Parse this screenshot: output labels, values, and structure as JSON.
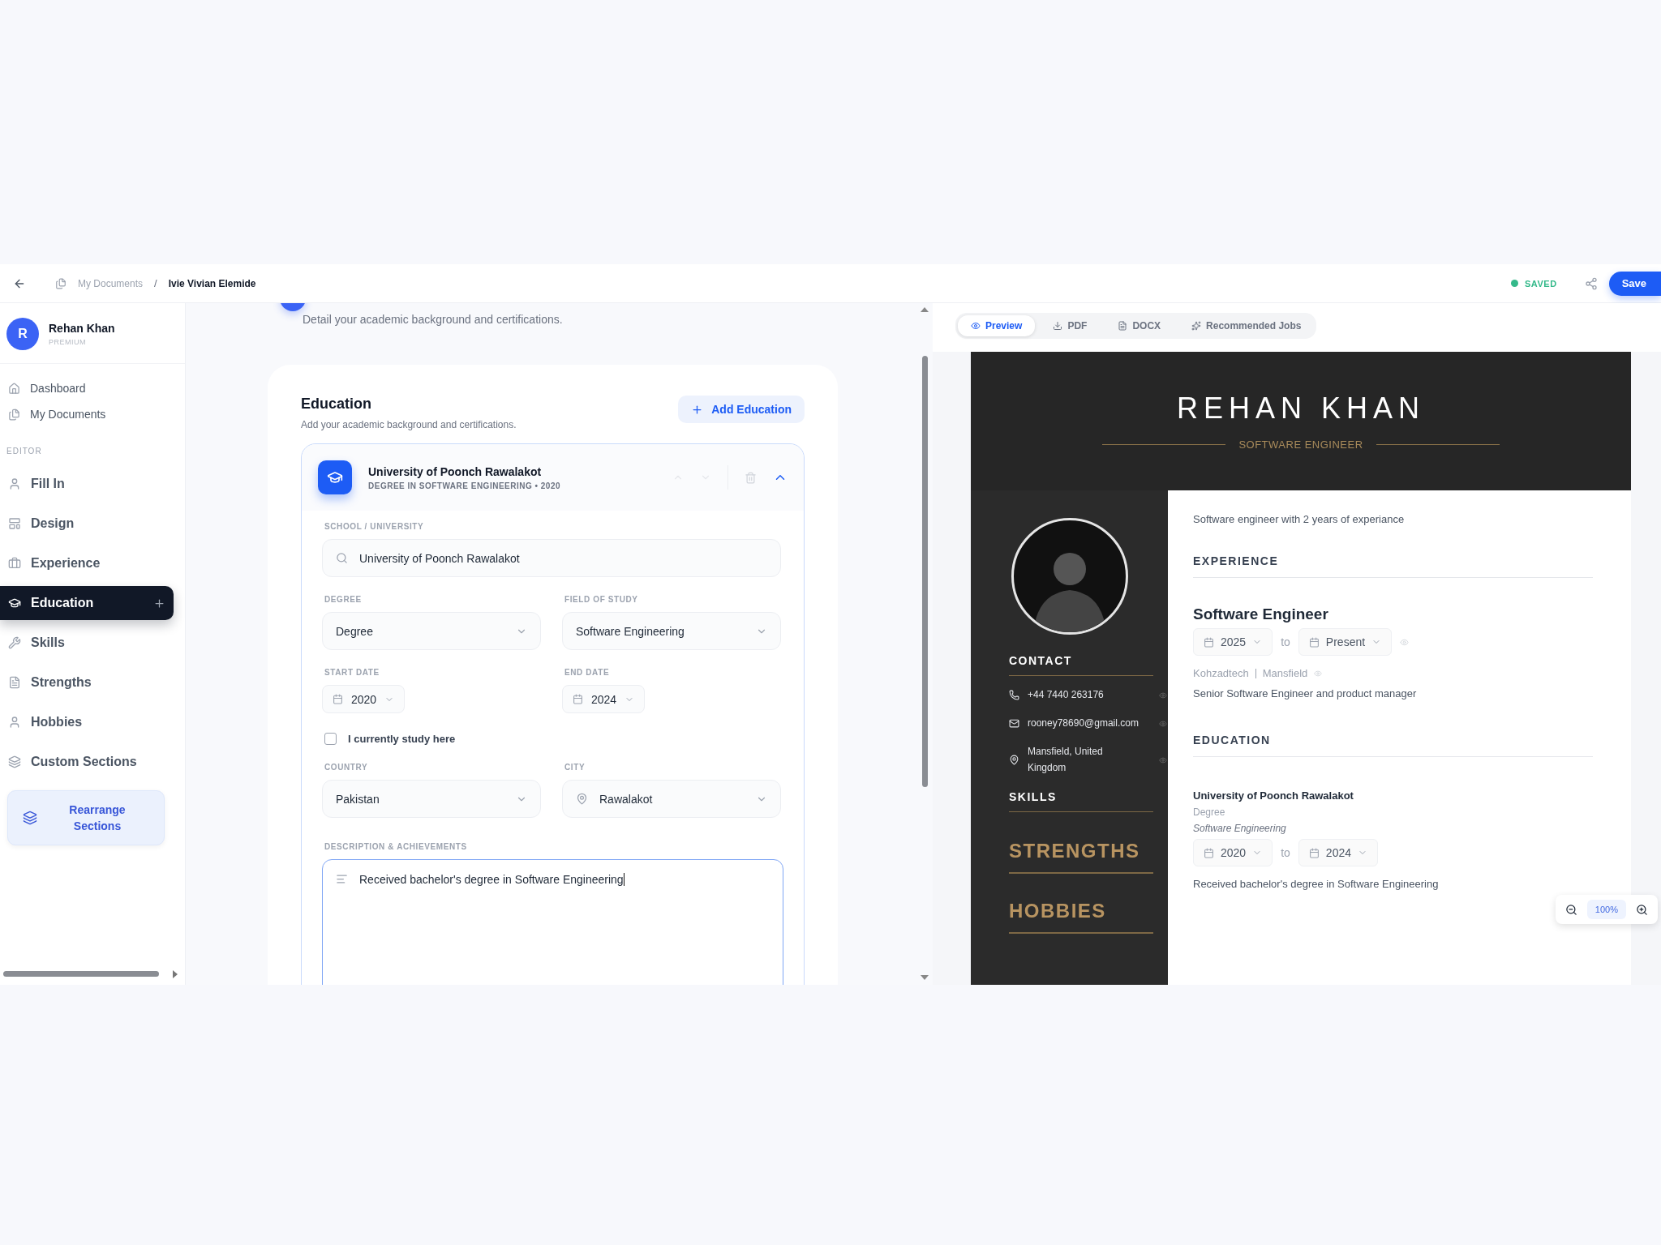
{
  "topbar": {
    "breadcrumb": [
      {
        "label": "My Documents",
        "current": false
      },
      {
        "label": "Ivie Vivian Elemide",
        "current": true
      }
    ],
    "separator": "/",
    "status": "SAVED",
    "save_button": "Save"
  },
  "sidebar": {
    "user": {
      "initial": "R",
      "name": "Rehan Khan",
      "plan": "PREMIUM"
    },
    "nav": [
      {
        "label": "Dashboard",
        "selected": false
      },
      {
        "label": "My Documents",
        "selected": false
      }
    ],
    "editor_label": "EDITOR",
    "editor_items": [
      {
        "label": "Fill In",
        "selected": false
      },
      {
        "label": "Design",
        "selected": false
      },
      {
        "label": "Experience",
        "selected": false
      },
      {
        "label": "Education",
        "selected": true
      },
      {
        "label": "Skills",
        "selected": false
      },
      {
        "label": "Strengths",
        "selected": false
      },
      {
        "label": "Hobbies",
        "selected": false
      },
      {
        "label": "Custom Sections",
        "selected": false
      }
    ],
    "rearrange_button": "Rearrange Sections"
  },
  "form": {
    "intro": "Detail your academic background and certifications.",
    "title": "Education",
    "subtitle": "Add your academic background and certifications.",
    "add_button": "Add Education",
    "entries": [
      {
        "title": "University of Poonch Rawalakot",
        "subtitle": "DEGREE IN SOFTWARE ENGINEERING • 2020",
        "expanded": true,
        "school": {
          "label": "SCHOOL / UNIVERSITY",
          "value": "University of Poonch Rawalakot"
        },
        "degree": {
          "label": "DEGREE",
          "value": "Degree"
        },
        "field_of_study": {
          "label": "FIELD OF STUDY",
          "value": "Software Engineering"
        },
        "start_date": {
          "label": "START DATE",
          "value": "2020"
        },
        "end_date": {
          "label": "END DATE",
          "value": "2024"
        },
        "current": {
          "label": "I currently study here",
          "checked": false
        },
        "country": {
          "label": "COUNTRY",
          "value": "Pakistan"
        },
        "city": {
          "label": "CITY",
          "value": "Rawalakot"
        },
        "description": {
          "label": "DESCRIPTION & ACHIEVEMENTS",
          "value": "Received bachelor's degree in Software Engineering"
        }
      }
    ]
  },
  "preview": {
    "tabs": [
      {
        "label": "Preview",
        "selected": true
      },
      {
        "label": "PDF",
        "selected": false
      },
      {
        "label": "DOCX",
        "selected": false
      },
      {
        "label": "Recommended Jobs",
        "selected": false
      }
    ],
    "resume": {
      "name": "REHAN KHAN",
      "title": "SOFTWARE ENGINEER",
      "summary": "Software engineer with 2 years of experiance",
      "contact_heading": "CONTACT",
      "contacts": [
        {
          "kind": "phone",
          "text": "+44 7440 263176"
        },
        {
          "kind": "email",
          "text": "rooney78690@gmail.com"
        },
        {
          "kind": "location",
          "text": "Mansfield, United Kingdom"
        }
      ],
      "skills_heading": "SKILLS",
      "strengths_heading": "STRENGTHS",
      "hobbies_heading": "HOBBIES",
      "experience_heading": "EXPERIENCE",
      "experience": [
        {
          "role": "Software Engineer",
          "start": "2025",
          "separator": "to",
          "end": "Present",
          "company": "Kohzadtech",
          "location": "Mansfield",
          "description": "Senior Software Engineer and product manager"
        }
      ],
      "education_heading": "EDUCATION",
      "education": [
        {
          "school": "University of Poonch Rawalakot",
          "degree": "Degree",
          "field": "Software Engineering",
          "start": "2020",
          "separator": "to",
          "end": "2024",
          "description": "Received bachelor's degree in Software Engineering"
        }
      ]
    },
    "zoom": "100%"
  }
}
